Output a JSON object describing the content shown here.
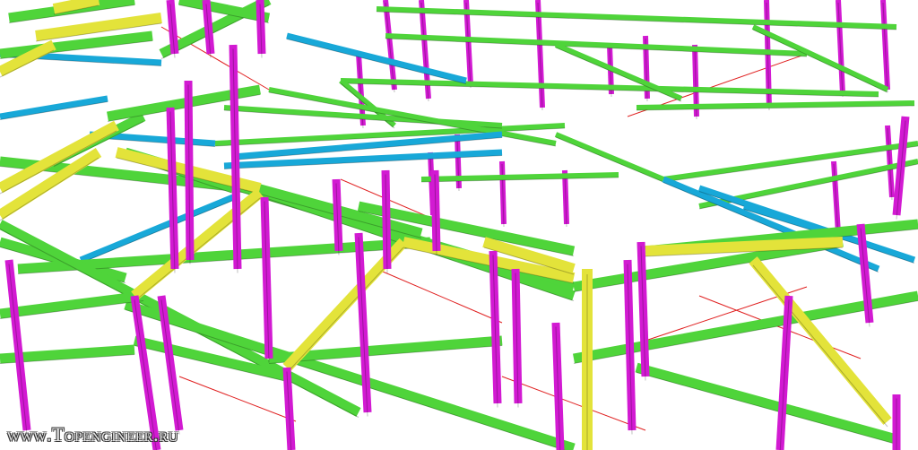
{
  "watermark": "www.Topengineer.ru",
  "colors": {
    "column": "#d21ad2",
    "beam": "#4fd43a",
    "rafter": "#e3e33a",
    "purlin": "#18a8d8",
    "bracing": "#e02020",
    "background": "#ffffff"
  }
}
